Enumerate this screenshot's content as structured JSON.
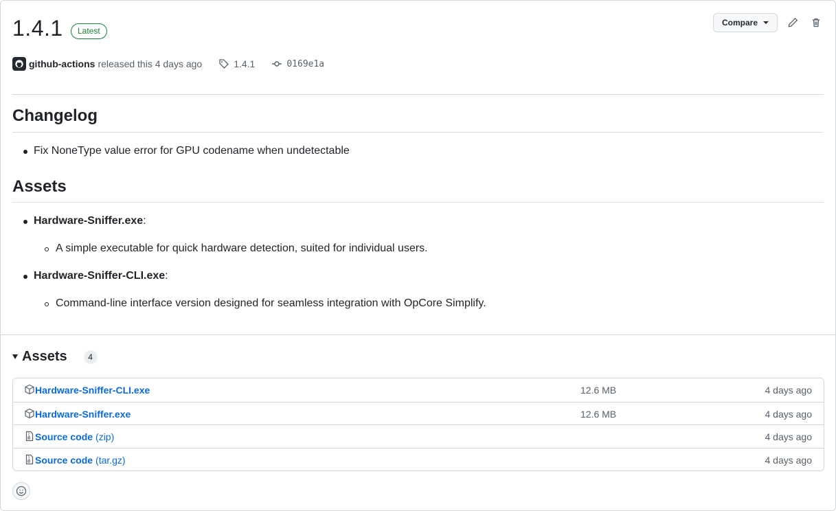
{
  "release": {
    "title": "1.4.1",
    "badge": "Latest",
    "author": "github-actions",
    "released_text": "released this 4 days ago",
    "tag": "1.4.1",
    "commit": "0169e1a"
  },
  "actions": {
    "compare_label": "Compare",
    "edit_icon": "pencil-icon",
    "delete_icon": "trash-icon"
  },
  "changelog": {
    "heading": "Changelog",
    "items": [
      "Fix NoneType value error for GPU codename when undetectable"
    ]
  },
  "assets_notes": {
    "heading": "Assets",
    "items": [
      {
        "name": "Hardware-Sniffer.exe",
        "suffix": ":",
        "desc": "A simple executable for quick hardware detection, suited for individual users."
      },
      {
        "name": "Hardware-Sniffer-CLI.exe",
        "suffix": ":",
        "desc": "Command-line interface version designed for seamless integration with OpCore Simplify."
      }
    ]
  },
  "assets": {
    "heading": "Assets",
    "count": "4",
    "rows": [
      {
        "icon": "package-icon",
        "name": "Hardware-Sniffer-CLI.exe",
        "ext": "",
        "size": "12.6 MB",
        "date": "4 days ago"
      },
      {
        "icon": "package-icon",
        "name": "Hardware-Sniffer.exe",
        "ext": "",
        "size": "12.6 MB",
        "date": "4 days ago"
      },
      {
        "icon": "file-zip-icon",
        "name": "Source code",
        "ext": "(zip)",
        "size": "",
        "date": "4 days ago"
      },
      {
        "icon": "file-zip-icon",
        "name": "Source code",
        "ext": "(tar.gz)",
        "size": "",
        "date": "4 days ago"
      }
    ]
  }
}
